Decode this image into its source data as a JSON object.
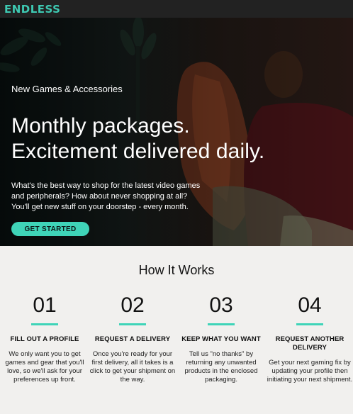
{
  "brand": {
    "logo": "ENDLESS",
    "accent": "#3fd4b8"
  },
  "hero": {
    "eyebrow": "New Games & Accessories",
    "headline": [
      "Monthly packages.",
      "Excitement delivered daily."
    ],
    "description": [
      "What's the best way to shop for the latest video games",
      "and peripherals? How about never shopping at all?",
      "You'll get new stuff on your doorstep - every month."
    ],
    "cta_label": "GET STARTED"
  },
  "how_it_works": {
    "title": "How It Works",
    "steps": [
      {
        "number": "01",
        "title": "FILL OUT A PROFILE",
        "text": "We only want you to get games and gear that you'll love, so we'll ask for your preferences up front."
      },
      {
        "number": "02",
        "title": "REQUEST A DELIVERY",
        "text": "Once you're ready for your first delivery, all it takes is a click to get your shipment on the way."
      },
      {
        "number": "03",
        "title": "KEEP WHAT YOU WANT",
        "text": "Tell us \"no thanks\" by returning any unwanted products in the enclosed packaging."
      },
      {
        "number": "04",
        "title": "REQUEST ANOTHER DELIVERY",
        "text": "Get your next gaming fix by updating your profile then initiating your next shipment."
      }
    ]
  }
}
